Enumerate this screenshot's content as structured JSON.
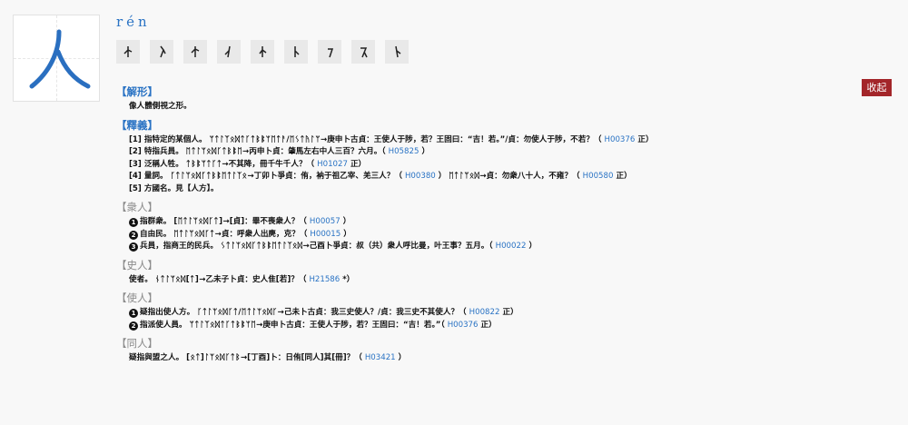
{
  "pinyin": "rén",
  "collapse_label": "收起",
  "oracle_forms": [
    "form-1",
    "form-2",
    "form-3",
    "form-4",
    "form-5",
    "form-6",
    "form-7",
    "form-8",
    "form-9"
  ],
  "sections": {
    "jiexing": {
      "title": "【解形】",
      "text": "像人體側視之形。"
    },
    "shiyi": {
      "title": "【釋義】",
      "items": [
        {
          "text": "[1] 指特定的某個人。",
          "glyphs": "ᛘᛏᛚᛉᛟᛞᛏᚴᛏᛒᛔᛘᛖᛏᚨ/ᛖᛊᛏᚤᛚᛘ",
          "after": "→庚申卜古貞：王使人于陟，若？王固曰：“吉！若。”/貞：勿使人于陟，不若？（",
          "ref": "H00376",
          "tail": "正）"
        },
        {
          "text": "[2] 特指兵員。",
          "glyphs": "ᛖᛏᛚᛘᛟᛞᚴᛏᛒᛔᛖ",
          "after": "→丙申卜貞：肇馬左右中人三百？六月。（",
          "ref": "H05825",
          "tail": "）"
        },
        {
          "text": "[3] 泛稱人牲。",
          "glyphs": "ᛏᛒᛔᛘᛏᚴᛏ",
          "after": "→不其降，冊千牛千人？（",
          "ref": "H01027",
          "tail": "正）"
        },
        {
          "text": "[4] 量詞。",
          "glyphs": "ᚴᛏᛚᛘᛟᛞᚴᛏᛒᛔᛖᛏᛚᛉᛟ",
          "after": "→丁卯卜爭貞：侑，衲于祖乙宰、羌三人？（",
          "ref": "H00380",
          "mid": "）",
          "glyphs2": "ᛖᛏᛚᛘᛟᛞ",
          "after2": "→貞：勿衆八十人，不雍？（",
          "ref2": "H00580",
          "tail": "正）"
        },
        {
          "text": "[5] 方國名。見【人方】。"
        }
      ]
    },
    "zhongren": {
      "title": "【衆人】",
      "items": [
        {
          "num": "1",
          "text": "指群衆。",
          "glyphs": "[ᛖᛏᛚᛘᛟᛞᚴᛏ]",
          "after": "→[貞]：畢不喪衆人？（",
          "ref": "H00057",
          "tail": "）"
        },
        {
          "num": "2",
          "text": "自由民。",
          "glyphs": "ᛖᛏᛚᛘᛟᛞᚴᛏ",
          "after": "→貞：呼衆人出麂，克？（",
          "ref": "H00015",
          "tail": "）"
        },
        {
          "num": "3",
          "text": "兵員，指商王的民兵。",
          "glyphs": "ᛊᛏᛚᛘᛟᛞᚴᛏᛒᛔᛖᛏᛚᛉᛟᛞ",
          "after": "→己酉卜爭貞：叔（共）衆人呼比曼，叶王事？五月。（",
          "ref": "H00022",
          "tail": "）"
        }
      ]
    },
    "shiren": {
      "title": "【史人】",
      "items": [
        {
          "text": "使者。",
          "glyphs": "ᚾᛏᛚᛘᛟᛞ[ᛏ]",
          "after": "→乙未子卜貞：史人隹[若]？（",
          "ref": "H21586",
          "tail": "*）"
        }
      ]
    },
    "shiren2": {
      "title": "【使人】",
      "items": [
        {
          "num": "1",
          "text": "疑指出使人方。",
          "glyphs": "ᚴᛏᛚᛘᛟᛞᚴᛏ/ᛖᛏᛚᛘᛟᛞᚴ",
          "after": "→己未卜古貞：我三史使人？/貞：我三史不其使人？（",
          "ref": "H00822",
          "tail": "正）"
        },
        {
          "num": "2",
          "text": "指派使人員。",
          "glyphs": "ᛘᛏᛚᛉᛟᛞᛏᚴᛏᛒᛔᛘᛖ",
          "after": "→庚申卜古貞：王使人于陟，若？王固曰：“吉！若。”（",
          "ref": "H00376",
          "tail": "正）"
        }
      ]
    },
    "tongren": {
      "title": "【同人】",
      "items": [
        {
          "text": "疑指與盟之人。",
          "glyphs": "[ᛟᛏ]ᛚᛘᛟᛞᚴᛏᛒ",
          "after": "→[丁酉]卜：日侑[同人]其[冊]？（",
          "ref": "H03421",
          "tail": "）"
        }
      ]
    }
  }
}
